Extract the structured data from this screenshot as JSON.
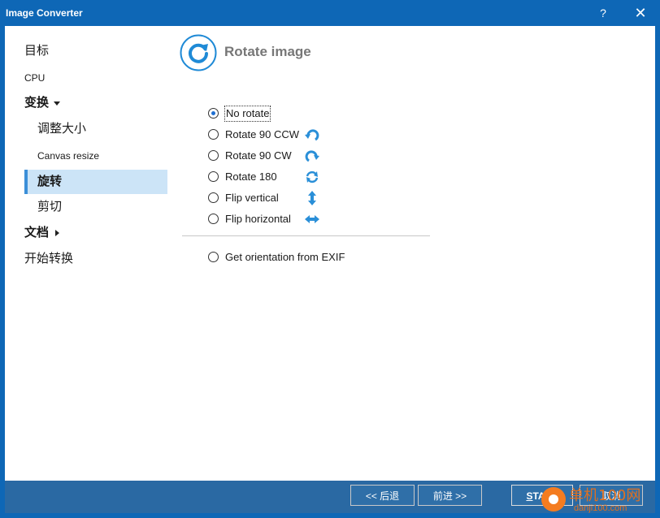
{
  "window": {
    "title": "Image Converter",
    "help_label": "?",
    "close_label": "✕"
  },
  "sidebar": {
    "items": [
      {
        "label": "目标"
      },
      {
        "label": "CPU"
      },
      {
        "label": "变换"
      },
      {
        "label": "调整大小"
      },
      {
        "label": "Canvas resize"
      },
      {
        "label": "旋转"
      },
      {
        "label": "剪切"
      },
      {
        "label": "文档"
      },
      {
        "label": "开始转换"
      }
    ]
  },
  "main": {
    "header_title": "Rotate image",
    "header_icon": "rotate-clockwise-icon",
    "options": [
      {
        "label": "No rotate",
        "checked": true
      },
      {
        "label": "Rotate 90 CCW",
        "icon": "rotate-ccw-icon"
      },
      {
        "label": "Rotate 90 CW",
        "icon": "rotate-cw-icon"
      },
      {
        "label": "Rotate 180",
        "icon": "rotate-180-icon"
      },
      {
        "label": "Flip vertical",
        "icon": "flip-vertical-icon"
      },
      {
        "label": "Flip horizontal",
        "icon": "flip-horizontal-icon"
      }
    ],
    "exif_option": {
      "label": "Get orientation from EXIF",
      "checked": false
    }
  },
  "footer": {
    "back_label": "<< 后退",
    "next_label": "前进 >>",
    "start_label_first": "S",
    "start_label_rest": "TART",
    "cancel_label": "取消"
  },
  "watermark": {
    "text": "单机100网",
    "url_text": "danji100.com"
  },
  "colors": {
    "titlebar": "#0e67b6",
    "footer": "#2a69a3",
    "selected": "#cce4f7",
    "accent": "#1f8ad6"
  }
}
